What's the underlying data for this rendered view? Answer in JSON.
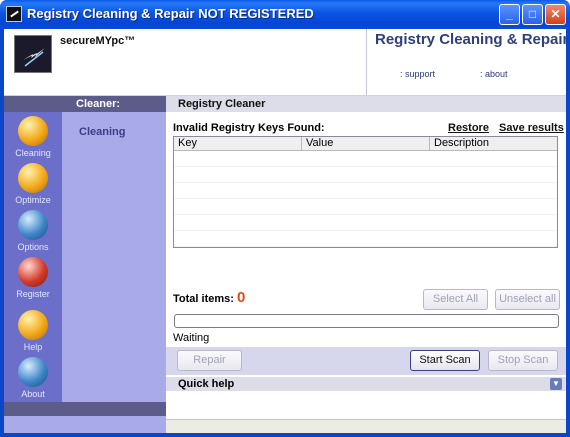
{
  "window": {
    "title": "Registry Cleaning & Repair NOT REGISTERED",
    "minimize_glyph": "_",
    "maximize_glyph": "□",
    "close_glyph": "✕"
  },
  "header": {
    "brand": "secureMYpc™",
    "title": "Registry Cleaning & Repair",
    "links": [
      ": support",
      ": about"
    ]
  },
  "nav": {
    "items": [
      {
        "label": "Cleaning",
        "icon": "broom-icon",
        "color": "#f2a818"
      },
      {
        "label": "Optimize",
        "icon": "wrench-icon",
        "color": "#f2a818"
      },
      {
        "label": "Options",
        "icon": "gear-icon",
        "color": "#3f86c8"
      },
      {
        "label": "Register",
        "icon": "document-icon",
        "color": "#d23a2a"
      },
      {
        "label": "Help",
        "icon": "lifebuoy-icon",
        "color": "#f2a818"
      },
      {
        "label": "About",
        "icon": "info-icon",
        "color": "#3f86c8"
      }
    ]
  },
  "submenu": {
    "header": "Cleaner:",
    "items": [
      "Cleaning"
    ]
  },
  "main": {
    "header": "Registry Cleaner",
    "keys_label": "Invalid Registry Keys Found:",
    "restore_link": "Restore",
    "save_link": "Save results",
    "columns": [
      "Key",
      "Value",
      "Description"
    ],
    "rows": [],
    "total_label": "Total items:",
    "total_value": "0",
    "select_all": "Select All",
    "unselect_all": "Unselect all",
    "progress_fraction": 0,
    "status": "Waiting",
    "repair": "Repair",
    "start_scan": "Start Scan",
    "stop_scan": "Stop Scan",
    "quick_help": "Quick help"
  }
}
